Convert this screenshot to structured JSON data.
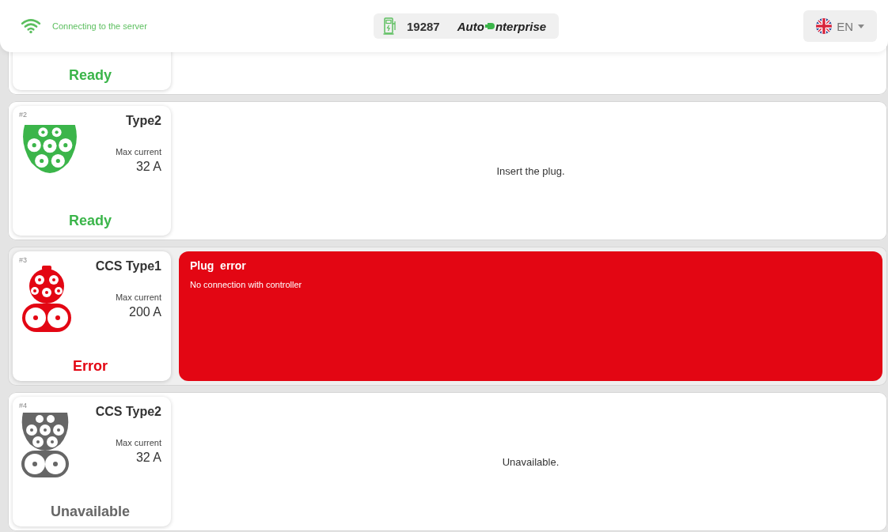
{
  "header": {
    "connection": "Connecting to the server",
    "station_id": "19287",
    "logo": {
      "before": "Auto",
      "after": "nterprise"
    },
    "language": "EN"
  },
  "connectors": [
    {
      "partial": true,
      "color": "#3bb54a",
      "status": "Ready"
    },
    {
      "partial": false,
      "number": "#2",
      "kind": "type2",
      "name": "Type2",
      "current_label": "Max current",
      "current": "32 A",
      "color": "#3bb54a",
      "status": "Ready",
      "message": "Insert the plug."
    },
    {
      "partial": false,
      "number": "#3",
      "kind": "ccs1",
      "name": "CCS Type1",
      "current_label": "Max current",
      "current": "200 A",
      "color": "#e30613",
      "status": "Error",
      "error_title": "Plug  error",
      "error_text": "No connection with controller"
    },
    {
      "partial": false,
      "number": "#4",
      "kind": "ccs2",
      "name": "CCS Type2",
      "current_label": "Max current",
      "current": "32 A",
      "color": "#666666",
      "status": "Unavailable",
      "message": "Unavailable."
    }
  ]
}
